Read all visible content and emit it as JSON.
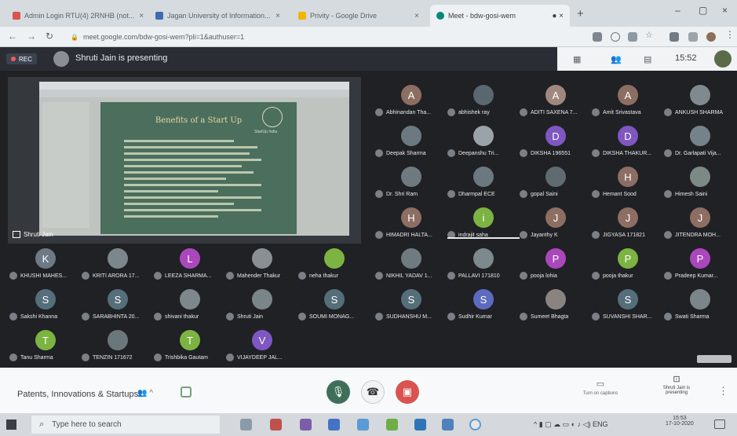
{
  "browser": {
    "tabs": [
      {
        "title": "Admin Login RTU(4) 2RNHB (not..."
      },
      {
        "title": "Jagan University of Information..."
      },
      {
        "title": "Privity - Google Drive"
      },
      {
        "title": "Meet - bdw-gosi-wem"
      }
    ],
    "new_tab": "+",
    "url": "meet.google.com/bdw-gosi-wem?pli=1&authuser=1"
  },
  "meet": {
    "rec_label": "REC",
    "presenting": "Shruti Jain is presenting",
    "clock": "15:52",
    "presentation": {
      "presenter_name": "Shruti Jain",
      "slide_title": "Benefits of a Start Up",
      "slide_logo_text": "StartUp India"
    },
    "participants": [
      {
        "name": "Abhinandan Tha...",
        "initial": "A",
        "color": "#8d6e63"
      },
      {
        "name": "abhishek ray",
        "initial": "",
        "color": "#5b6770"
      },
      {
        "name": "ADITI SAXENA 7...",
        "initial": "A",
        "color": "#a1887f"
      },
      {
        "name": "Amit Srivastava",
        "initial": "A",
        "color": "#8d6e63"
      },
      {
        "name": "ANKUSH SHARMA",
        "initial": "",
        "color": "#7f8a8f"
      },
      {
        "name": "Deepak Sharma",
        "initial": "",
        "color": "#6b7a80"
      },
      {
        "name": "Deepanshu Tri...",
        "initial": "",
        "color": "#9aa4a8"
      },
      {
        "name": "DIKSHA 196551",
        "initial": "D",
        "color": "#7e57c2"
      },
      {
        "name": "DIKSHA THAKUR...",
        "initial": "D",
        "color": "#7e57c2"
      },
      {
        "name": "Dr. Garlapati Vija...",
        "initial": "",
        "color": "#76828a"
      },
      {
        "name": "Dr. Shri Ram",
        "initial": "",
        "color": "#6f7a80"
      },
      {
        "name": "Dharmpal ECE",
        "initial": "",
        "color": "#6c7880"
      },
      {
        "name": "gopal Saini",
        "initial": "",
        "color": "#5f6b71"
      },
      {
        "name": "Hemant Sood",
        "initial": "H",
        "color": "#8d6e63"
      },
      {
        "name": "Himesh Saini",
        "initial": "",
        "color": "#7c8a86"
      },
      {
        "name": "HIMADRI HALTA...",
        "initial": "H",
        "color": "#8d6e63"
      },
      {
        "name": "indrajit saha",
        "initial": "i",
        "color": "#7cb342"
      },
      {
        "name": "Jayanthy K",
        "initial": "J",
        "color": "#8d6e63"
      },
      {
        "name": "JIGYASA 171821",
        "initial": "J",
        "color": "#8d6e63"
      },
      {
        "name": "JITENDRA MOH...",
        "initial": "J",
        "color": "#8d6e63"
      },
      {
        "name": "KHUSHI MAHES...",
        "initial": "K",
        "color": "#6d7a86"
      },
      {
        "name": "KRITI ARORA 17...",
        "initial": "",
        "color": "#7b878c"
      },
      {
        "name": "LEEZA SHARMA...",
        "initial": "L",
        "color": "#ab47bc"
      },
      {
        "name": "Mahender Thakur",
        "initial": "",
        "color": "#8a8f94"
      },
      {
        "name": "neha thakur",
        "initial": "",
        "color": "#7cb342"
      },
      {
        "name": "NIKHIL YADAV 1...",
        "initial": "",
        "color": "#6f7b80"
      },
      {
        "name": "PALLAVI 171810",
        "initial": "",
        "color": "#7c8a8e"
      },
      {
        "name": "pooja lohia",
        "initial": "P",
        "color": "#ab47bc"
      },
      {
        "name": "pooja thakur",
        "initial": "P",
        "color": "#7cb342"
      },
      {
        "name": "Pradeep Kumar...",
        "initial": "P",
        "color": "#ab47bc"
      },
      {
        "name": "Sakshi Khanna",
        "initial": "S",
        "color": "#546e7a"
      },
      {
        "name": "SARABHINTA 20...",
        "initial": "S",
        "color": "#546e7a"
      },
      {
        "name": "shivani thakur",
        "initial": "",
        "color": "#7d888d"
      },
      {
        "name": "Shruti Jain",
        "initial": "",
        "color": "#7a8589"
      },
      {
        "name": "SOUMI MONAG...",
        "initial": "S",
        "color": "#546e7a"
      },
      {
        "name": "SUDHANSHU M...",
        "initial": "S",
        "color": "#546e7a"
      },
      {
        "name": "Sudhir Kumar",
        "initial": "S",
        "color": "#5c6bc0"
      },
      {
        "name": "Sumeet Bhagta",
        "initial": "",
        "color": "#8a8480"
      },
      {
        "name": "SUVANSHI SHAR...",
        "initial": "S",
        "color": "#546e7a"
      },
      {
        "name": "Swati Sharma",
        "initial": "",
        "color": "#7b868a"
      },
      {
        "name": "Tanu Sharma",
        "initial": "T",
        "color": "#7cb342"
      },
      {
        "name": "TENZIN 171672",
        "initial": "",
        "color": "#6c777c"
      },
      {
        "name": "Trishbika Gautam",
        "initial": "T",
        "color": "#7cb342"
      },
      {
        "name": "VIJAYDEEP JAL...",
        "initial": "V",
        "color": "#7e57c2"
      }
    ],
    "bottom": {
      "meeting_title": "Patents, Innovations & Startups",
      "captions_label": "Turn on captions",
      "present_status": "Shruti Jain is presenting"
    }
  },
  "taskbar": {
    "search_placeholder": "Type here to search",
    "tray_lang": "ENG",
    "time": "15:53",
    "date": "17-10-2020"
  }
}
